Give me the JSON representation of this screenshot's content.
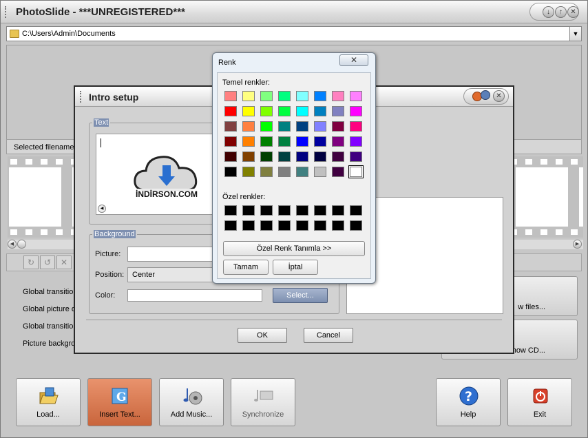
{
  "window": {
    "title": "PhotoSlide - ***UNREGISTERED***"
  },
  "pathbar": {
    "path": "C:\\Users\\Admin\\Documents"
  },
  "filename": {
    "label": "Selected filename:"
  },
  "settings": {
    "rows": [
      "Global transition",
      "Global picture d",
      "Global transition",
      "Picture backgro"
    ],
    "view_files_label": "w files...",
    "create_cd_label": "Create slideshow CD..."
  },
  "bottom_bar": {
    "buttons": [
      {
        "label": "Load...",
        "icon": "folder-open-icon"
      },
      {
        "label": "Insert Text...",
        "icon": "text-insert-icon"
      },
      {
        "label": "Add Music...",
        "icon": "music-icon"
      },
      {
        "label": "Synchronize",
        "icon": "sync-icon"
      },
      {
        "label": "Help",
        "icon": "help-icon"
      },
      {
        "label": "Exit",
        "icon": "power-icon"
      }
    ]
  },
  "intro": {
    "title": "Intro setup",
    "text_group": "Text",
    "background_group": "Background",
    "picture_label": "Picture:",
    "position_label": "Position:",
    "position_value": "Center",
    "color_label": "Color:",
    "select_label": "Select...",
    "ok_label": "OK",
    "cancel_label": "Cancel"
  },
  "renk": {
    "title": "Renk",
    "basic_label": "Temel renkler:",
    "custom_label": "Özel renkler:",
    "define_label": "Özel Renk Tanımla >>",
    "ok_label": "Tamam",
    "cancel_label": "İptal",
    "close_glyph": "✕",
    "basic_colors": [
      [
        "#ff8080",
        "#ffff80",
        "#80ff80",
        "#00ff80",
        "#80ffff",
        "#0080ff",
        "#ff80c0",
        "#ff80ff"
      ],
      [
        "#ff0000",
        "#ffff00",
        "#80ff00",
        "#00ff40",
        "#00ffff",
        "#0080c0",
        "#8080c0",
        "#ff00ff"
      ],
      [
        "#804040",
        "#ff8040",
        "#00ff00",
        "#008080",
        "#004080",
        "#8080ff",
        "#800040",
        "#ff0080"
      ],
      [
        "#800000",
        "#ff8000",
        "#008000",
        "#008040",
        "#0000ff",
        "#0000a0",
        "#800080",
        "#8000ff"
      ],
      [
        "#400000",
        "#804000",
        "#004000",
        "#004040",
        "#000080",
        "#000040",
        "#400040",
        "#400080"
      ],
      [
        "#000000",
        "#808000",
        "#808040",
        "#808080",
        "#408080",
        "#c0c0c0",
        "#400040",
        "#ffffff"
      ]
    ],
    "custom_colors": [
      [
        "#000000",
        "#000000",
        "#000000",
        "#000000",
        "#000000",
        "#000000",
        "#000000",
        "#000000"
      ],
      [
        "#000000",
        "#000000",
        "#000000",
        "#000000",
        "#000000",
        "#000000",
        "#000000",
        "#000000"
      ]
    ]
  },
  "watermark": {
    "text": "İNDİRSON.COM"
  }
}
